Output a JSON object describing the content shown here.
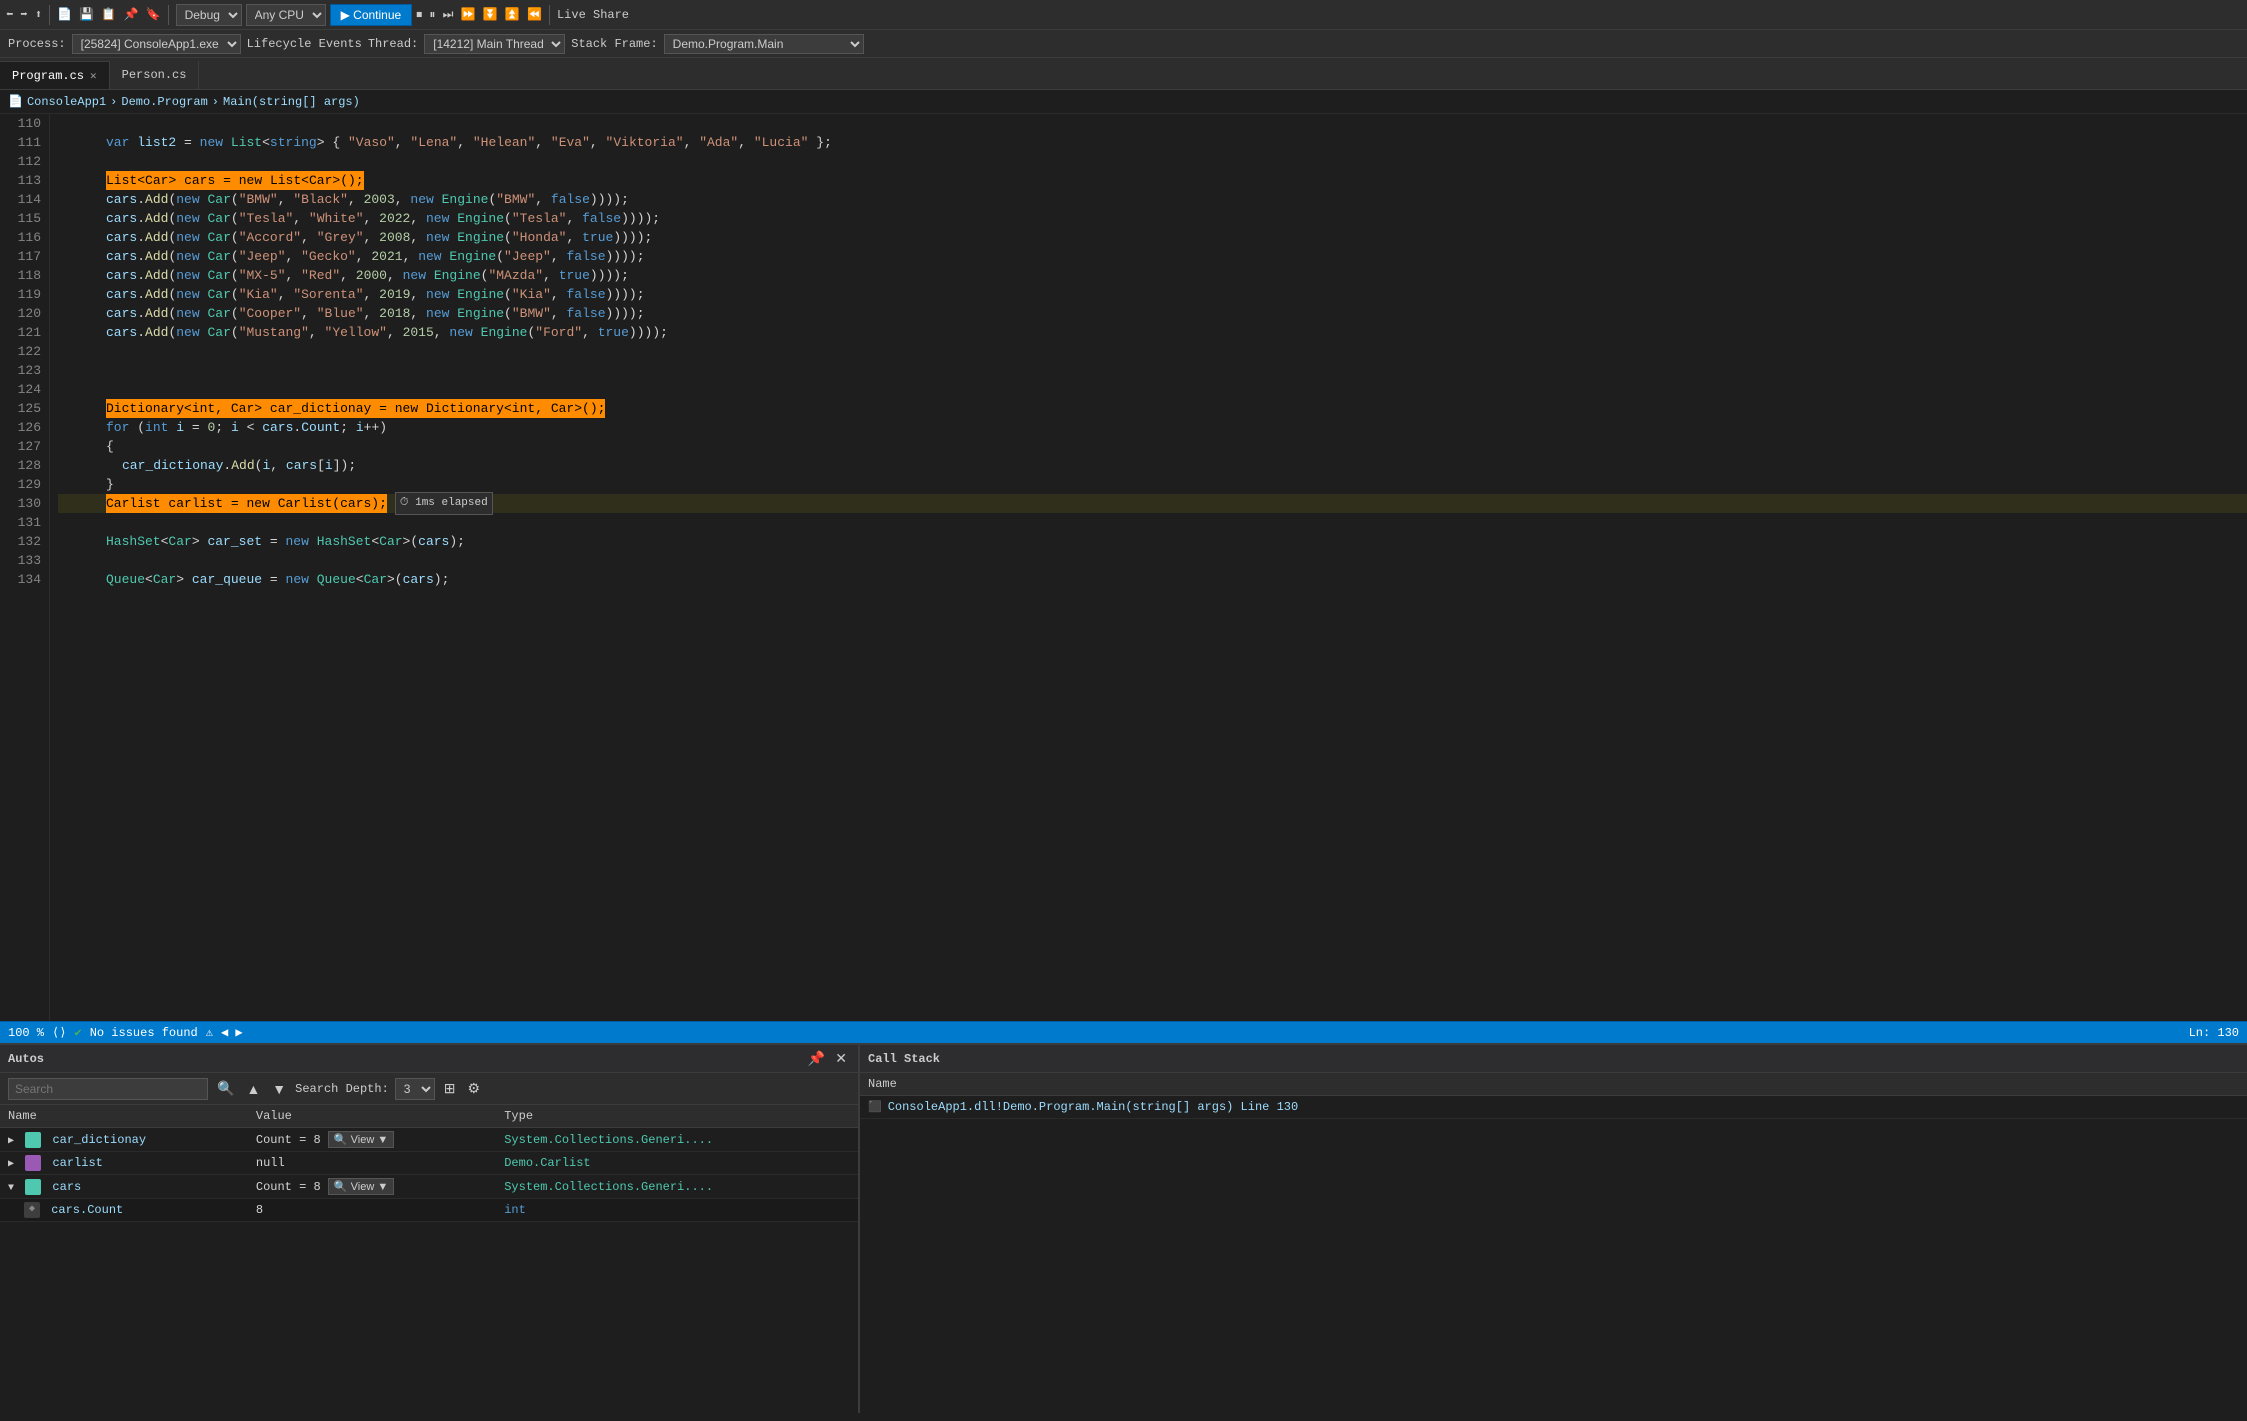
{
  "toolbar": {
    "debug_label": "Debug",
    "any_cpu_label": "Any CPU",
    "continue_label": "▶ Continue",
    "live_share_label": "Live Share"
  },
  "process_bar": {
    "process_label": "Process:",
    "process_value": "[25824] ConsoleApp1.exe",
    "lifecycle_label": "Lifecycle Events",
    "thread_label": "Thread:",
    "thread_value": "[14212] Main Thread",
    "stack_frame_label": "Stack Frame:",
    "stack_frame_value": "Demo.Program.Main"
  },
  "tabs": [
    {
      "label": "Program.cs",
      "active": false
    },
    {
      "label": "Person.cs",
      "active": false
    }
  ],
  "breadcrumb": {
    "app": "ConsoleApp1",
    "class": "Demo.Program",
    "method": "Main(string[] args)"
  },
  "code_lines": [
    {
      "num": 110,
      "indent": 3,
      "code": ""
    },
    {
      "num": 111,
      "indent": 3,
      "code": "var list2 = new List<string> { \"Vaso\", \"Lena\", \"Helean\", \"Eva\", \"Viktoria\", \"Ada\", \"Lucia\" };"
    },
    {
      "num": 112,
      "indent": 3,
      "code": ""
    },
    {
      "num": 113,
      "indent": 3,
      "code": "List<Car> cars = new List<Car>();",
      "breakpoint": true,
      "highlighted": true
    },
    {
      "num": 114,
      "indent": 3,
      "code": "cars.Add(new Car(\"BMW\", \"Black\", 2003, new Engine(\"BMW\", false)));"
    },
    {
      "num": 115,
      "indent": 3,
      "code": "cars.Add(new Car(\"Tesla\", \"White\", 2022, new Engine(\"Tesla\", false)));"
    },
    {
      "num": 116,
      "indent": 3,
      "code": "cars.Add(new Car(\"Accord\", \"Grey\", 2008, new Engine(\"Honda\", true)));"
    },
    {
      "num": 117,
      "indent": 3,
      "code": "cars.Add(new Car(\"Jeep\", \"Gecko\", 2021, new Engine(\"Jeep\", false)));"
    },
    {
      "num": 118,
      "indent": 3,
      "code": "cars.Add(new Car(\"MX-5\", \"Red\", 2000, new Engine(\"MAzda\", true)));"
    },
    {
      "num": 119,
      "indent": 3,
      "code": "cars.Add(new Car(\"Kia\", \"Sorenta\", 2019, new Engine(\"Kia\", false)));"
    },
    {
      "num": 120,
      "indent": 3,
      "code": "cars.Add(new Car(\"Cooper\", \"Blue\", 2018, new Engine(\"BMW\", false)));"
    },
    {
      "num": 121,
      "indent": 3,
      "code": "cars.Add(new Car(\"Mustang\", \"Yellow\", 2015, new Engine(\"Ford\", true)));"
    },
    {
      "num": 122,
      "indent": 3,
      "code": ""
    },
    {
      "num": 123,
      "indent": 3,
      "code": ""
    },
    {
      "num": 124,
      "indent": 3,
      "code": ""
    },
    {
      "num": 125,
      "indent": 3,
      "code": "Dictionary<int, Car> car_dictionay = new Dictionary<int, Car>();",
      "highlighted": true
    },
    {
      "num": 126,
      "indent": 3,
      "code": "for (int i = 0; i < cars.Count; i++)"
    },
    {
      "num": 127,
      "indent": 3,
      "code": "{"
    },
    {
      "num": 128,
      "indent": 4,
      "code": "car_dictionay.Add(i, cars[i]);"
    },
    {
      "num": 129,
      "indent": 3,
      "code": "}"
    },
    {
      "num": 130,
      "indent": 3,
      "code": "Carlist carlist = new Carlist(cars);",
      "current": true,
      "breakpoint_arrow": true
    },
    {
      "num": 131,
      "indent": 3,
      "code": ""
    },
    {
      "num": 132,
      "indent": 3,
      "code": "HashSet<Car> car_set = new HashSet<Car>(cars);"
    },
    {
      "num": 133,
      "indent": 3,
      "code": ""
    },
    {
      "num": 134,
      "indent": 3,
      "code": "Queue<Car> car_queue = new Queue<Car>(cars);"
    }
  ],
  "status_bar": {
    "zoom": "100 %",
    "no_issues": "No issues found",
    "line_info": "Ln: 130"
  },
  "autos_panel": {
    "title": "Autos",
    "search_placeholder": "Search",
    "search_depth_label": "Search Depth:",
    "search_depth_value": "3",
    "columns": [
      "Name",
      "Value",
      "Type"
    ],
    "rows": [
      {
        "name": "car_dictionay",
        "value": "Count = 8",
        "type": "System.Collections.Generi....",
        "expanded": true,
        "indent": 0,
        "has_view": true,
        "view_label": "View"
      },
      {
        "name": "carlist",
        "value": "null",
        "type": "Demo.Carlist",
        "expanded": false,
        "indent": 0,
        "has_view": false
      },
      {
        "name": "cars",
        "value": "Count = 8",
        "type": "System.Collections.Generi....",
        "expanded": true,
        "indent": 0,
        "has_view": true,
        "view_label": "View"
      },
      {
        "name": "cars.Count",
        "value": "8",
        "type": "int",
        "expanded": false,
        "indent": 1,
        "has_view": false
      }
    ]
  },
  "callstack_panel": {
    "title": "Call Stack",
    "columns": [
      "Name"
    ],
    "rows": [
      {
        "name": "ConsoleApp1.dll!Demo.Program.Main(string[] args) Line 130",
        "active": true
      }
    ]
  }
}
